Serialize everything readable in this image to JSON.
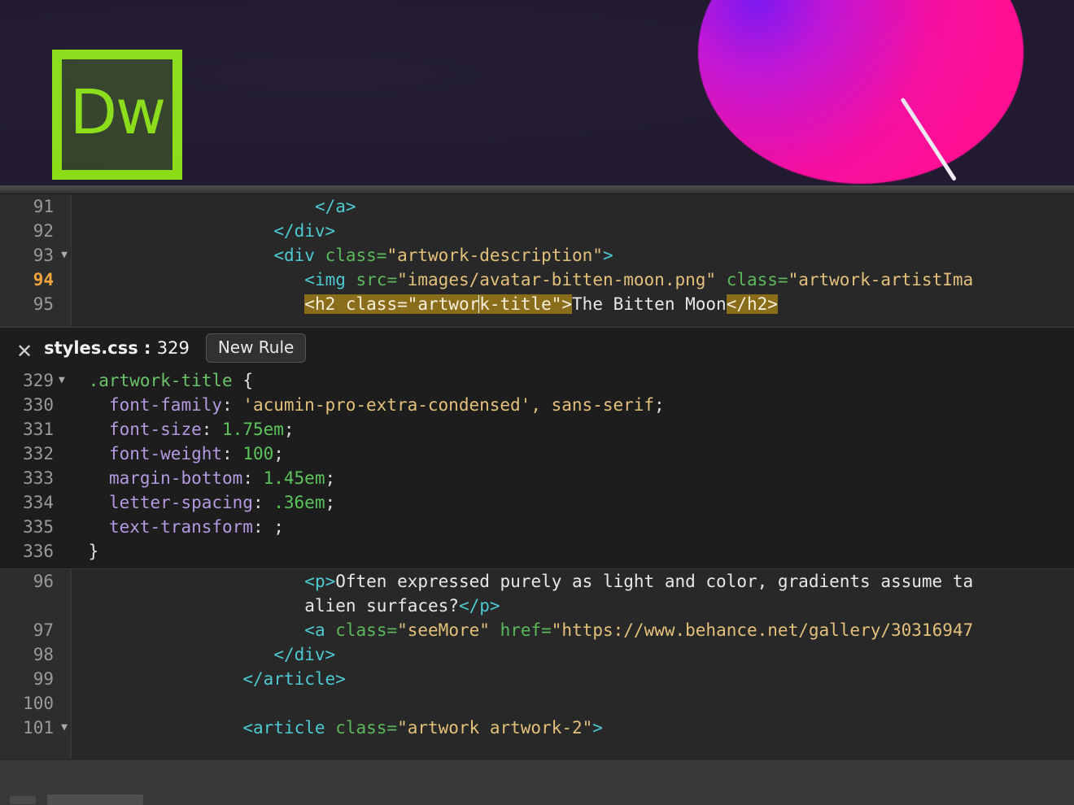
{
  "app": {
    "name": "Adobe Dreamweaver",
    "logo_text": "Dw"
  },
  "preview": {
    "description": "artwork preview with magenta gradient circle and white streak"
  },
  "html_editor_top": {
    "lines": [
      {
        "number": "91",
        "fold": "",
        "active": false,
        "indent": 23,
        "segments": [
          {
            "t": "tag",
            "v": "</a>"
          }
        ]
      },
      {
        "number": "92",
        "fold": "",
        "active": false,
        "indent": 19,
        "segments": [
          {
            "t": "tag",
            "v": "</div>"
          }
        ]
      },
      {
        "number": "93",
        "fold": "▼",
        "active": false,
        "indent": 19,
        "segments": [
          {
            "t": "tag",
            "v": "<div"
          },
          {
            "t": "sp",
            "v": " "
          },
          {
            "t": "attr",
            "v": "class="
          },
          {
            "t": "str",
            "v": "\"artwork-description\""
          },
          {
            "t": "tag",
            "v": ">"
          }
        ]
      },
      {
        "number": "94",
        "fold": "",
        "active": true,
        "indent": 22,
        "segments": [
          {
            "t": "tag",
            "v": "<img"
          },
          {
            "t": "sp",
            "v": " "
          },
          {
            "t": "attr",
            "v": "src="
          },
          {
            "t": "str",
            "v": "\"images/avatar-bitten-moon.png\""
          },
          {
            "t": "sp",
            "v": " "
          },
          {
            "t": "attr",
            "v": "class="
          },
          {
            "t": "str",
            "v": "\"artwork-artistIma"
          }
        ]
      },
      {
        "number": "95",
        "fold": "",
        "active": false,
        "indent": 22,
        "segments": [
          {
            "t": "hl",
            "v": "<h2 class=\"artwor"
          },
          {
            "t": "caret",
            "v": ""
          },
          {
            "t": "hl",
            "v": "k-title\">"
          },
          {
            "t": "txt",
            "v": "The Bitten Moon"
          },
          {
            "t": "hl",
            "v": "</h2>"
          }
        ]
      }
    ]
  },
  "css_panel": {
    "close_label": "✕",
    "file_name": "styles.css",
    "separator": " : ",
    "line_number": "329",
    "new_rule_label": "New Rule",
    "lines": [
      {
        "number": "329",
        "fold": "▼",
        "indent": 1,
        "segments": [
          {
            "t": "sel",
            "v": ".artwork-title"
          },
          {
            "t": "pun",
            "v": " "
          },
          {
            "t": "brace",
            "v": "{"
          }
        ]
      },
      {
        "number": "330",
        "fold": "",
        "indent": 3,
        "segments": [
          {
            "t": "prop",
            "v": "font-family"
          },
          {
            "t": "pun",
            "v": ": "
          },
          {
            "t": "str",
            "v": "'acumin-pro-extra-condensed', sans-serif"
          },
          {
            "t": "pun",
            "v": ";"
          }
        ]
      },
      {
        "number": "331",
        "fold": "",
        "indent": 3,
        "segments": [
          {
            "t": "prop",
            "v": "font-size"
          },
          {
            "t": "pun",
            "v": ": "
          },
          {
            "t": "val",
            "v": "1.75em"
          },
          {
            "t": "pun",
            "v": ";"
          }
        ]
      },
      {
        "number": "332",
        "fold": "",
        "indent": 3,
        "segments": [
          {
            "t": "prop",
            "v": "font-weight"
          },
          {
            "t": "pun",
            "v": ": "
          },
          {
            "t": "val",
            "v": "100"
          },
          {
            "t": "pun",
            "v": ";"
          }
        ]
      },
      {
        "number": "333",
        "fold": "",
        "indent": 3,
        "segments": [
          {
            "t": "prop",
            "v": "margin-bottom"
          },
          {
            "t": "pun",
            "v": ": "
          },
          {
            "t": "val",
            "v": "1.45em"
          },
          {
            "t": "pun",
            "v": ";"
          }
        ]
      },
      {
        "number": "334",
        "fold": "",
        "indent": 3,
        "segments": [
          {
            "t": "prop",
            "v": "letter-spacing"
          },
          {
            "t": "pun",
            "v": ": "
          },
          {
            "t": "val",
            "v": ".36em"
          },
          {
            "t": "pun",
            "v": ";"
          }
        ]
      },
      {
        "number": "335",
        "fold": "",
        "indent": 3,
        "segments": [
          {
            "t": "prop",
            "v": "text-transform"
          },
          {
            "t": "pun",
            "v": ": "
          },
          {
            "t": "pun",
            "v": ";"
          }
        ]
      },
      {
        "number": "336",
        "fold": "",
        "indent": 1,
        "segments": [
          {
            "t": "brace",
            "v": "}"
          }
        ]
      }
    ]
  },
  "html_editor_bottom": {
    "lines": [
      {
        "number": "96",
        "fold": "",
        "active": false,
        "indent": 22,
        "segments": [
          {
            "t": "tag",
            "v": "<p>"
          },
          {
            "t": "txt",
            "v": "Often expressed purely as light and color, gradients assume ta"
          }
        ]
      },
      {
        "number": "",
        "fold": "",
        "active": false,
        "indent": 22,
        "wrapped": true,
        "segments": [
          {
            "t": "txt",
            "v": "alien surfaces?"
          },
          {
            "t": "tag",
            "v": "</p>"
          }
        ]
      },
      {
        "number": "97",
        "fold": "",
        "active": false,
        "indent": 22,
        "segments": [
          {
            "t": "tag",
            "v": "<a"
          },
          {
            "t": "sp",
            "v": " "
          },
          {
            "t": "attr",
            "v": "class="
          },
          {
            "t": "str",
            "v": "\"seeMore\""
          },
          {
            "t": "sp",
            "v": " "
          },
          {
            "t": "attr",
            "v": "href="
          },
          {
            "t": "str",
            "v": "\"https://www.behance.net/gallery/30316947"
          }
        ]
      },
      {
        "number": "98",
        "fold": "",
        "active": false,
        "indent": 19,
        "segments": [
          {
            "t": "tag",
            "v": "</div>"
          }
        ]
      },
      {
        "number": "99",
        "fold": "",
        "active": false,
        "indent": 16,
        "segments": [
          {
            "t": "tag",
            "v": "</article>"
          }
        ]
      },
      {
        "number": "100",
        "fold": "",
        "active": false,
        "indent": 0,
        "segments": []
      },
      {
        "number": "101",
        "fold": "▼",
        "active": false,
        "indent": 16,
        "segments": [
          {
            "t": "tag",
            "v": "<article"
          },
          {
            "t": "sp",
            "v": " "
          },
          {
            "t": "attr",
            "v": "class="
          },
          {
            "t": "str",
            "v": "\"artwork artwork-2\""
          },
          {
            "t": "tag",
            "v": ">"
          }
        ]
      }
    ]
  },
  "colors": {
    "preview_bg": "#211a31",
    "editor_bg": "#282828",
    "gutter_bg": "#2d2d2d",
    "css_panel_bg": "#1d1d1d",
    "selection_highlight": "#8a6d1a",
    "active_line_number": "#f0a43c",
    "tag_color": "#4ec9d0",
    "attribute_color": "#5cb85c",
    "string_color": "#e3c07b",
    "css_property_color": "#b49ae0",
    "css_value_color": "#5cc45c",
    "css_selector_color": "#6ac36a",
    "logo_green": "#8bdd1a",
    "blob_magenta": "#f50fa0"
  }
}
